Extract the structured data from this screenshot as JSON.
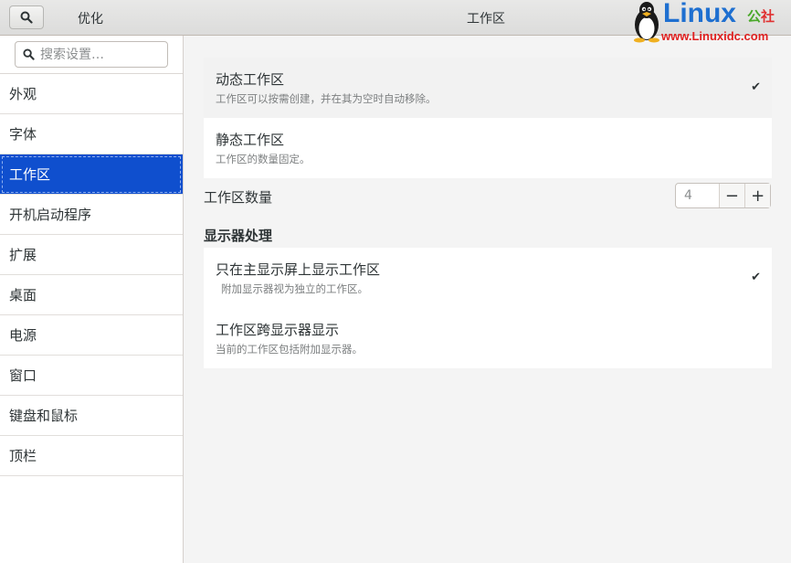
{
  "header": {
    "app_title": "优化",
    "page_title": "工作区",
    "search_icon": "search-icon"
  },
  "watermark": {
    "main": "Linux",
    "sub_1": "公",
    "sub_2": "社",
    "url": "www.Linuxidc.com"
  },
  "sidebar": {
    "search_placeholder": "搜索设置…",
    "items": [
      {
        "label": "外观",
        "selected": false
      },
      {
        "label": "字体",
        "selected": false
      },
      {
        "label": "工作区",
        "selected": true
      },
      {
        "label": "开机启动程序",
        "selected": false
      },
      {
        "label": "扩展",
        "selected": false
      },
      {
        "label": "桌面",
        "selected": false
      },
      {
        "label": "电源",
        "selected": false
      },
      {
        "label": "窗口",
        "selected": false
      },
      {
        "label": "键盘和鼠标",
        "selected": false
      },
      {
        "label": "顶栏",
        "selected": false
      }
    ]
  },
  "workspaces": {
    "dynamic": {
      "title": "动态工作区",
      "subtitle": "工作区可以按需创建，并在其为空时自动移除。",
      "checked": true
    },
    "static": {
      "title": "静态工作区",
      "subtitle": "工作区的数量固定。",
      "checked": false
    },
    "count_label": "工作区数量",
    "count_value": "4",
    "minus": "−",
    "plus": "+"
  },
  "display": {
    "section_title": "显示器处理",
    "primary_only": {
      "title": "只在主显示屏上显示工作区",
      "subtitle": "附加显示器视为独立的工作区。",
      "checked": true
    },
    "span": {
      "title": "工作区跨显示器显示",
      "subtitle": "当前的工作区包括附加显示器。",
      "checked": false
    },
    "check_glyph": "✔"
  }
}
